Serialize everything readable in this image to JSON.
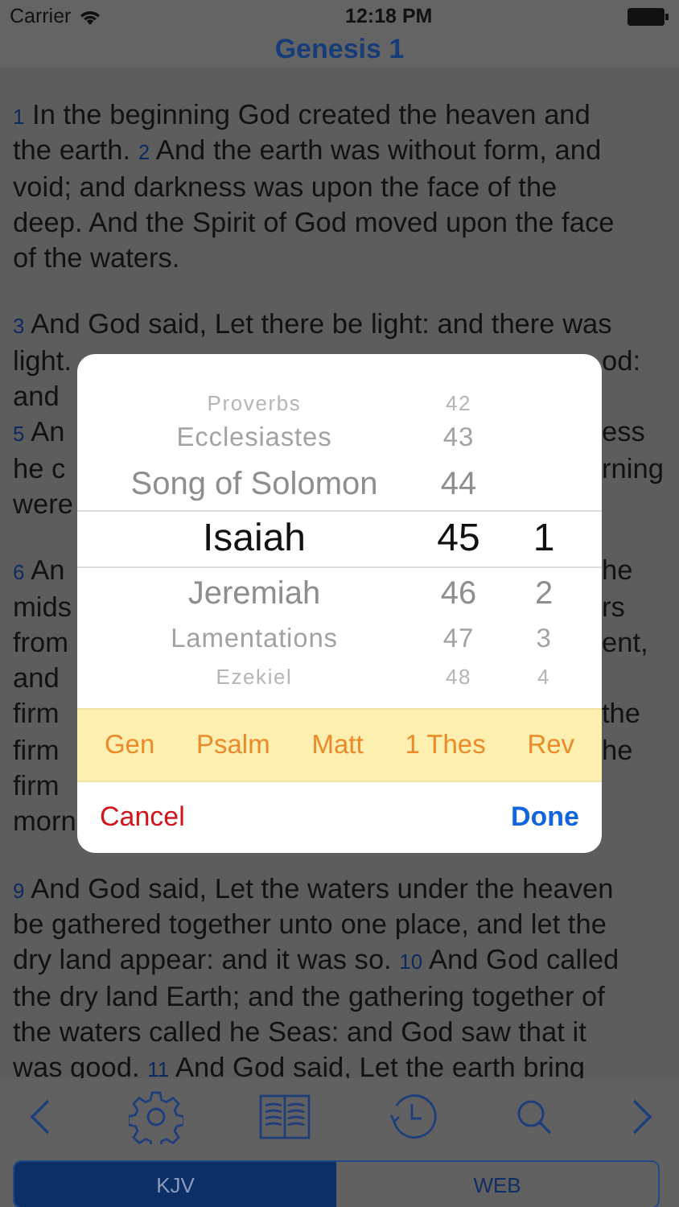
{
  "status_bar": {
    "carrier": "Carrier",
    "time": "12:18 PM"
  },
  "nav_title": "Genesis 1",
  "passage": {
    "paragraphs": [
      {
        "lines": [
          {
            "parts": [
              {
                "kind": "verse",
                "text": "1"
              },
              {
                "kind": "text",
                "text": "In the beginning God created the heaven and"
              }
            ]
          },
          {
            "parts": [
              {
                "kind": "text",
                "text": "the earth."
              },
              {
                "kind": "verse",
                "text": "2"
              },
              {
                "kind": "text",
                "text": "And the earth was without form, and"
              }
            ]
          },
          {
            "parts": [
              {
                "kind": "text",
                "text": "void; and darkness was upon the face of the"
              }
            ]
          },
          {
            "parts": [
              {
                "kind": "text",
                "text": "deep. And the Spirit of God moved upon the face"
              }
            ]
          },
          {
            "parts": [
              {
                "kind": "text",
                "text": "of the waters."
              }
            ]
          }
        ]
      },
      {
        "lines": [
          {
            "parts": [
              {
                "kind": "verse",
                "text": "3"
              },
              {
                "kind": "text",
                "text": "And God said, Let there be light: and there was"
              }
            ]
          },
          {
            "parts": [
              {
                "kind": "text",
                "text": "light."
              }
            ],
            "tail": "od:"
          },
          {
            "parts": [
              {
                "kind": "text",
                "text": "and"
              }
            ]
          },
          {
            "parts": [
              {
                "kind": "verse",
                "text": "5"
              },
              {
                "kind": "text",
                "text": "An"
              }
            ],
            "tail": "ess"
          },
          {
            "parts": [
              {
                "kind": "text",
                "text": "he c"
              }
            ],
            "tail": "rning"
          },
          {
            "parts": [
              {
                "kind": "text",
                "text": "were"
              }
            ]
          }
        ]
      },
      {
        "lines": [
          {
            "parts": [
              {
                "kind": "verse",
                "text": "6"
              },
              {
                "kind": "text",
                "text": "An"
              }
            ],
            "tail": "he"
          },
          {
            "parts": [
              {
                "kind": "text",
                "text": "mids"
              }
            ],
            "tail": "rs"
          },
          {
            "parts": [
              {
                "kind": "text",
                "text": "from"
              }
            ],
            "tail": "ent,"
          },
          {
            "parts": [
              {
                "kind": "text",
                "text": "and"
              }
            ]
          },
          {
            "parts": [
              {
                "kind": "text",
                "text": "firm"
              }
            ],
            "tail": "the"
          },
          {
            "parts": [
              {
                "kind": "text",
                "text": "firm"
              }
            ],
            "tail": "he"
          },
          {
            "parts": [
              {
                "kind": "text",
                "text": "firm"
              }
            ]
          },
          {
            "parts": [
              {
                "kind": "text",
                "text": "morn"
              }
            ]
          }
        ]
      },
      {
        "lines": [
          {
            "parts": [
              {
                "kind": "verse",
                "text": "9"
              },
              {
                "kind": "text",
                "text": "And God said, Let the waters under the heaven"
              }
            ]
          },
          {
            "parts": [
              {
                "kind": "text",
                "text": "be gathered together unto one place, and let the"
              }
            ]
          },
          {
            "parts": [
              {
                "kind": "text",
                "text": "dry land appear: and it was so."
              },
              {
                "kind": "verse",
                "text": "10"
              },
              {
                "kind": "text",
                "text": "And God called"
              }
            ]
          },
          {
            "parts": [
              {
                "kind": "text",
                "text": "the dry land Earth; and the gathering together of"
              }
            ]
          },
          {
            "parts": [
              {
                "kind": "text",
                "text": "the waters called he Seas: and God saw that it"
              }
            ]
          },
          {
            "parts": [
              {
                "kind": "text",
                "text": "was good."
              },
              {
                "kind": "verse",
                "text": "11"
              },
              {
                "kind": "text",
                "text": "And God said, Let the earth bring"
              }
            ]
          }
        ]
      }
    ]
  },
  "picker": {
    "rows": [
      {
        "book": "Proverbs",
        "number": "42",
        "selected": false
      },
      {
        "book": "Ecclesiastes",
        "number": "43",
        "selected": false
      },
      {
        "book": "Song of Solomon",
        "number": "44",
        "selected": false
      },
      {
        "book": "Isaiah",
        "number": "45",
        "chapter": "1",
        "selected": true
      },
      {
        "book": "Jeremiah",
        "number": "46",
        "chapter": "2",
        "selected": false
      },
      {
        "book": "Lamentations",
        "number": "47",
        "chapter": "3",
        "selected": false
      },
      {
        "book": "Ezekiel",
        "number": "48",
        "chapter": "4",
        "selected": false
      }
    ]
  },
  "shortcuts": [
    "Gen",
    "Psalm",
    "Matt",
    "1 Thes",
    "Rev"
  ],
  "dialog_buttons": {
    "cancel": "Cancel",
    "done": "Done"
  },
  "versions": [
    {
      "label": "KJV",
      "selected": true
    },
    {
      "label": "WEB",
      "selected": false
    }
  ]
}
